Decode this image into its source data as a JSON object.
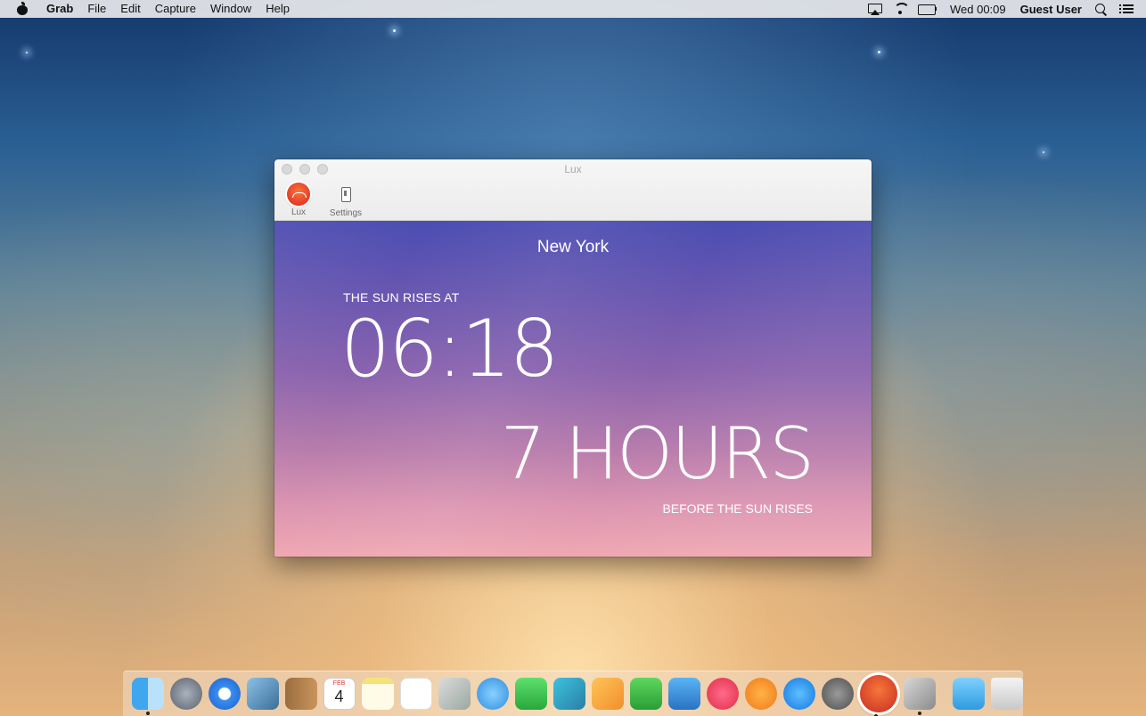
{
  "menubar": {
    "app_name": "Grab",
    "items": [
      "File",
      "Edit",
      "Capture",
      "Window",
      "Help"
    ],
    "clock": "Wed 00:09",
    "user": "Guest User"
  },
  "window": {
    "title": "Lux",
    "toolbar": [
      {
        "label": "Lux",
        "icon": "lux-icon"
      },
      {
        "label": "Settings",
        "icon": "switch-icon"
      }
    ],
    "city": "New York",
    "rises_label": "THE SUN RISES AT",
    "rise_time": "06:18",
    "hours_value": "7 HOURS",
    "before_label": "BEFORE THE SUN RISES"
  },
  "dock": {
    "calendar_month": "FEB",
    "calendar_day": "4",
    "apps": [
      "Finder",
      "Launchpad",
      "Safari",
      "Mail",
      "Contacts",
      "Calendar",
      "Notes",
      "Reminders",
      "Photo Booth",
      "Messages",
      "FaceTime",
      "Photos",
      "Pages",
      "Numbers",
      "Keynote",
      "iTunes",
      "iBooks",
      "App Store",
      "System Preferences",
      "Lux",
      "Grab",
      "Downloads",
      "Trash"
    ]
  },
  "colors": {
    "content_top": "#4b4db2",
    "content_bottom": "#f0a8b2",
    "lux_accent": "#e9442a"
  }
}
